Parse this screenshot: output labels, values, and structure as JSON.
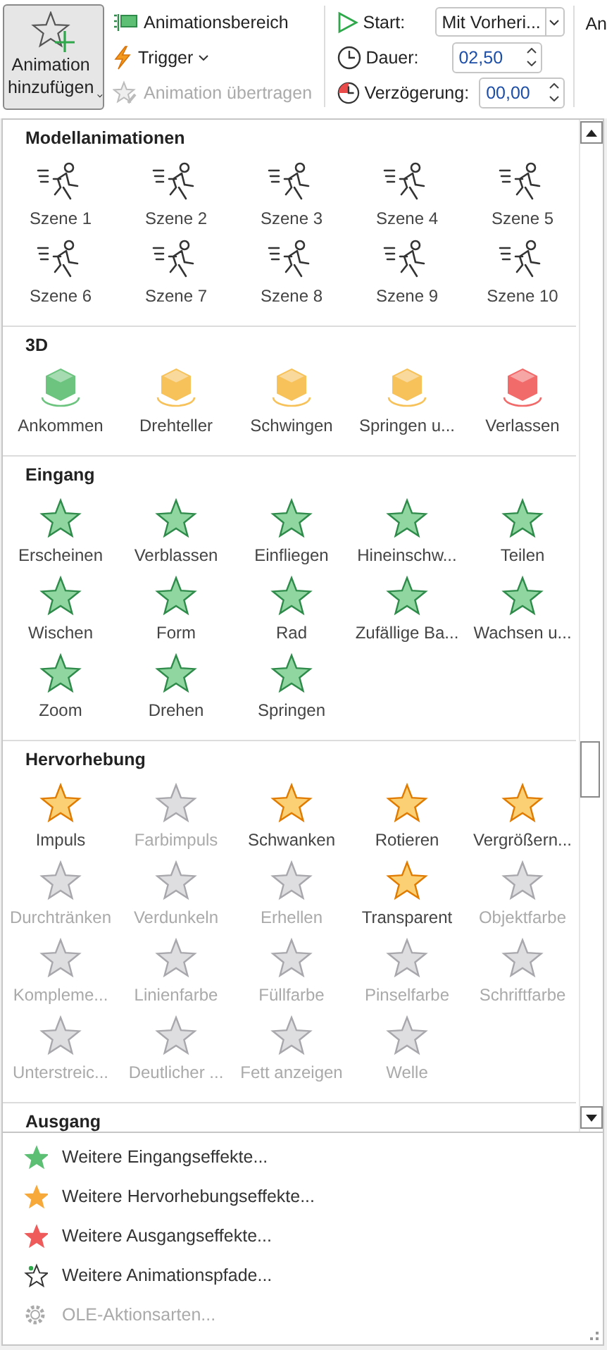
{
  "ribbon": {
    "add_animation": {
      "label": "Animation hinzufügen"
    },
    "commands": [
      {
        "kind": "pane",
        "label": "Animationsbereich",
        "has_menu": false,
        "disabled": false
      },
      {
        "kind": "trigger",
        "label": "Trigger",
        "has_menu": true,
        "disabled": false
      },
      {
        "kind": "painter",
        "label": "Animation übertragen",
        "has_menu": false,
        "disabled": true
      }
    ],
    "timing": [
      {
        "kind": "dropdown",
        "label": "Start:",
        "value": "Mit Vorheri..."
      },
      {
        "kind": "spinner",
        "label": "Dauer:",
        "value": "02,50"
      },
      {
        "kind": "spinner",
        "label": "Verzögerung:",
        "value": "00,00"
      }
    ],
    "next_group_label": "An"
  },
  "gallery": {
    "sections": [
      {
        "title": "Modellanimationen",
        "kind": "figure",
        "items": [
          {
            "label": "Szene 1"
          },
          {
            "label": "Szene 2"
          },
          {
            "label": "Szene 3"
          },
          {
            "label": "Szene 4"
          },
          {
            "label": "Szene 5"
          },
          {
            "label": "Szene 6"
          },
          {
            "label": "Szene 7"
          },
          {
            "label": "Szene 8"
          },
          {
            "label": "Szene 9"
          },
          {
            "label": "Szene 10"
          }
        ]
      },
      {
        "title": "3D",
        "kind": "cube",
        "items": [
          {
            "label": "Ankommen",
            "color": "#6cc47f"
          },
          {
            "label": "Drehteller",
            "color": "#f7c25a"
          },
          {
            "label": "Schwingen",
            "color": "#f7c25a"
          },
          {
            "label": "Springen u...",
            "color": "#f7c25a"
          },
          {
            "label": "Verlassen",
            "color": "#f26b6b"
          }
        ]
      },
      {
        "title": "Eingang",
        "kind": "entrance",
        "items": [
          {
            "label": "Erscheinen"
          },
          {
            "label": "Verblassen"
          },
          {
            "label": "Einfliegen"
          },
          {
            "label": "Hineinschw..."
          },
          {
            "label": "Teilen"
          },
          {
            "label": "Wischen"
          },
          {
            "label": "Form"
          },
          {
            "label": "Rad"
          },
          {
            "label": "Zufällige Ba..."
          },
          {
            "label": "Wachsen u..."
          },
          {
            "label": "Zoom"
          },
          {
            "label": "Drehen"
          },
          {
            "label": "Springen"
          }
        ]
      },
      {
        "title": "Hervorhebung",
        "kind": "emphasis",
        "items": [
          {
            "label": "Impuls",
            "disabled": false
          },
          {
            "label": "Farbimpuls",
            "disabled": true
          },
          {
            "label": "Schwanken",
            "disabled": false
          },
          {
            "label": "Rotieren",
            "disabled": false
          },
          {
            "label": "Vergrößern...",
            "disabled": false
          },
          {
            "label": "Durchtränken",
            "disabled": true
          },
          {
            "label": "Verdunkeln",
            "disabled": true
          },
          {
            "label": "Erhellen",
            "disabled": true
          },
          {
            "label": "Transparent",
            "disabled": false
          },
          {
            "label": "Objektfarbe",
            "disabled": true
          },
          {
            "label": "Kompleme...",
            "disabled": true
          },
          {
            "label": "Linienfarbe",
            "disabled": true
          },
          {
            "label": "Füllfarbe",
            "disabled": true
          },
          {
            "label": "Pinselfarbe",
            "disabled": true
          },
          {
            "label": "Schriftfarbe",
            "disabled": true
          },
          {
            "label": "Unterstreic...",
            "disabled": true
          },
          {
            "label": "Deutlicher ...",
            "disabled": true
          },
          {
            "label": "Fett anzeigen",
            "disabled": true
          },
          {
            "label": "Welle",
            "disabled": true
          }
        ]
      },
      {
        "title": "Ausgang"
      }
    ]
  },
  "menu": [
    {
      "kind": "star",
      "color": "#5cbf73",
      "label": "Weitere Eingangseffekte...",
      "disabled": false
    },
    {
      "kind": "star",
      "color": "#f7a93a",
      "label": "Weitere Hervorhebungseffekte...",
      "disabled": false
    },
    {
      "kind": "star",
      "color": "#ef5b5b",
      "label": "Weitere Ausgangseffekte...",
      "disabled": false
    },
    {
      "kind": "outline-star",
      "label": "Weitere Animationspfade...",
      "disabled": false
    },
    {
      "kind": "gear",
      "label": "OLE-Aktionsarten...",
      "disabled": true
    }
  ]
}
